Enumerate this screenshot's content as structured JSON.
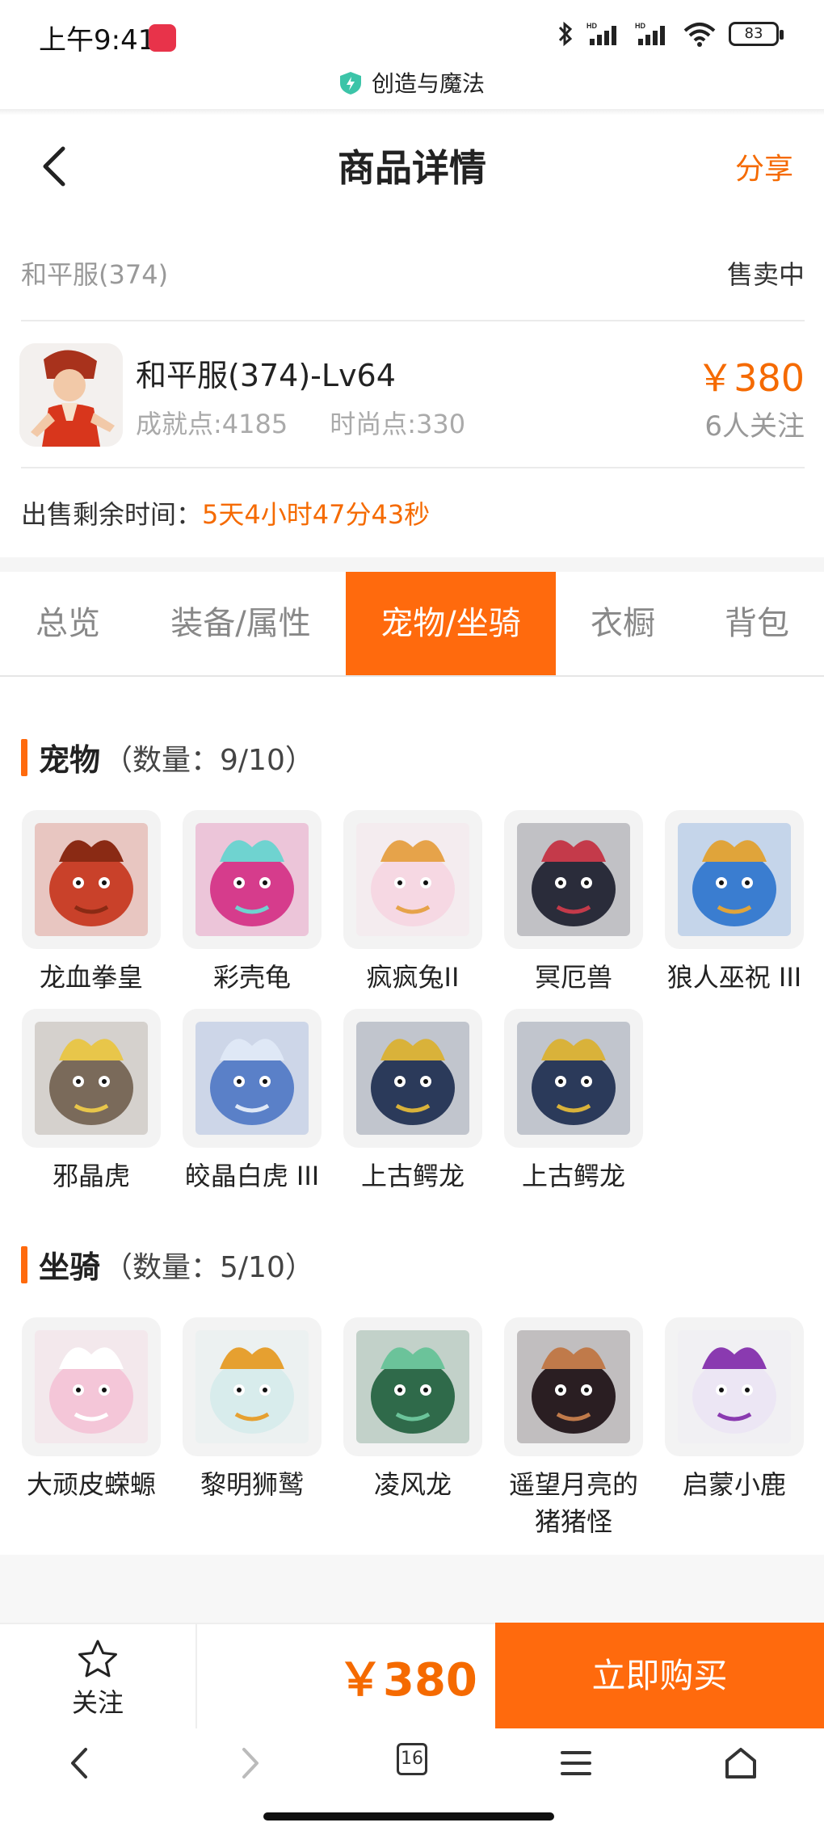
{
  "status_bar": {
    "time": "上午9:41",
    "app_badge": "小红书",
    "battery": "83"
  },
  "browser": {
    "url_title": "创造与魔法",
    "tab_count": "16"
  },
  "header": {
    "title": "商品详情",
    "share_label": "分享"
  },
  "product": {
    "server": "和平服(374)",
    "sale_status": "售卖中",
    "title": "和平服(374)-Lv64",
    "achievement": "成就点:4185",
    "fashion": "时尚点:330",
    "price": "￥380",
    "followers": "6人关注",
    "remaining_label": "出售剩余时间：",
    "remaining_value": "5天4小时47分43秒"
  },
  "tabs": [
    {
      "label": "总览",
      "active": false
    },
    {
      "label": "装备/属性",
      "active": false
    },
    {
      "label": "宠物/坐骑",
      "active": true
    },
    {
      "label": "衣橱",
      "active": false
    },
    {
      "label": "背包",
      "active": false
    }
  ],
  "pets": {
    "title": "宠物",
    "count": "（数量：9/10）",
    "items": [
      {
        "name": "龙血拳皇",
        "color": "#c9412a",
        "accent": "#8a2a14"
      },
      {
        "name": "彩壳龟",
        "color": "#d63c8c",
        "accent": "#6fd3d0"
      },
      {
        "name": "疯疯兔II",
        "color": "#f6d8e3",
        "accent": "#e6a34a"
      },
      {
        "name": "冥厄兽",
        "color": "#2a2c3a",
        "accent": "#c43a4a"
      },
      {
        "name": "狼人巫祝 III",
        "color": "#3a7dd0",
        "accent": "#e0a43a"
      },
      {
        "name": "邪晶虎",
        "color": "#7a6a5a",
        "accent": "#e8c64a"
      },
      {
        "name": "皎晶白虎 III",
        "color": "#5a80c8",
        "accent": "#dfe8f6"
      },
      {
        "name": "上古鳄龙",
        "color": "#2b3a5a",
        "accent": "#d9b23a"
      },
      {
        "name": "上古鳄龙",
        "color": "#2b3a5a",
        "accent": "#d9b23a"
      }
    ]
  },
  "mounts": {
    "title": "坐骑",
    "count": "（数量：5/10）",
    "items": [
      {
        "name": "大顽皮蝾螈",
        "color": "#f4c6d8",
        "accent": "#ffffff"
      },
      {
        "name": "黎明狮鹫",
        "color": "#d8ecec",
        "accent": "#e6a030"
      },
      {
        "name": "凌风龙",
        "color": "#2f6a4a",
        "accent": "#6bc39a"
      },
      {
        "name": "遥望月亮的猪猪怪",
        "color": "#2a1e22",
        "accent": "#c07a4a"
      },
      {
        "name": "启蒙小鹿",
        "color": "#ece6f4",
        "accent": "#8a3ab0"
      }
    ]
  },
  "action_bar": {
    "follow_label": "关注",
    "price": "￥380",
    "buy_label": "立即购买"
  },
  "theme": {
    "accent": "#ff6a0d",
    "price_color": "#f56a00"
  }
}
